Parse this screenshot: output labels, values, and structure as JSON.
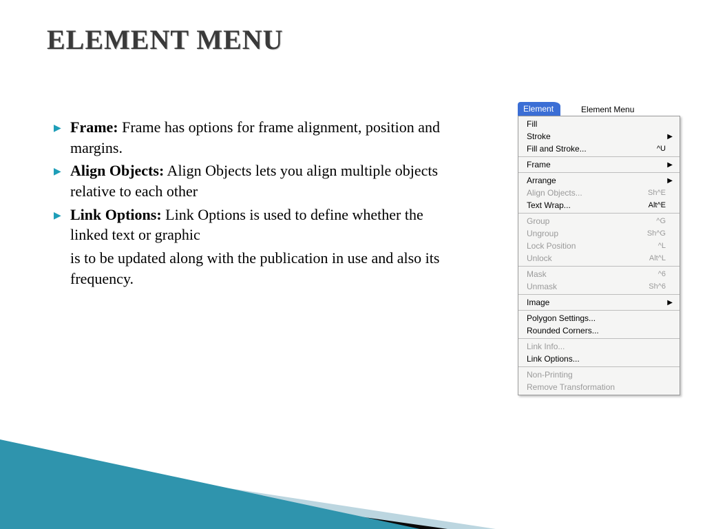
{
  "title": "ELEMENT MENU",
  "bullets": [
    {
      "label": "Frame:",
      "text": " Frame has options for frame alignment, position and margins."
    },
    {
      "label": " Align Objects:",
      "text": " Align Objects  lets  you align  multiple  objects  relative  to each other"
    },
    {
      "label": "Link Options:",
      "text": "  Link Options is used to define whether the linked text or graphic"
    }
  ],
  "continuation": "is to be updated along with the publication in use and also its frequency.",
  "menu": {
    "tab": "Element",
    "caption": "Element Menu",
    "groups": [
      [
        {
          "label": "Fill",
          "shortcut": "",
          "arrow": false,
          "disabled": false
        },
        {
          "label": "Stroke",
          "shortcut": "",
          "arrow": true,
          "disabled": false
        },
        {
          "label": "Fill and Stroke...",
          "shortcut": "^U",
          "arrow": false,
          "disabled": false
        }
      ],
      [
        {
          "label": "Frame",
          "shortcut": "",
          "arrow": true,
          "disabled": false
        }
      ],
      [
        {
          "label": "Arrange",
          "shortcut": "",
          "arrow": true,
          "disabled": false
        },
        {
          "label": "Align Objects...",
          "shortcut": "Sh^E",
          "arrow": false,
          "disabled": true
        },
        {
          "label": "Text Wrap...",
          "shortcut": "Alt^E",
          "arrow": false,
          "disabled": false
        }
      ],
      [
        {
          "label": "Group",
          "shortcut": "^G",
          "arrow": false,
          "disabled": true
        },
        {
          "label": "Ungroup",
          "shortcut": "Sh^G",
          "arrow": false,
          "disabled": true
        },
        {
          "label": "Lock Position",
          "shortcut": "^L",
          "arrow": false,
          "disabled": true
        },
        {
          "label": "Unlock",
          "shortcut": "Alt^L",
          "arrow": false,
          "disabled": true
        }
      ],
      [
        {
          "label": "Mask",
          "shortcut": "^6",
          "arrow": false,
          "disabled": true
        },
        {
          "label": "Unmask",
          "shortcut": "Sh^6",
          "arrow": false,
          "disabled": true
        }
      ],
      [
        {
          "label": "Image",
          "shortcut": "",
          "arrow": true,
          "disabled": false
        }
      ],
      [
        {
          "label": "Polygon Settings...",
          "shortcut": "",
          "arrow": false,
          "disabled": false
        },
        {
          "label": "Rounded Corners...",
          "shortcut": "",
          "arrow": false,
          "disabled": false
        }
      ],
      [
        {
          "label": "Link Info...",
          "shortcut": "",
          "arrow": false,
          "disabled": true
        },
        {
          "label": "Link Options...",
          "shortcut": "",
          "arrow": false,
          "disabled": false
        }
      ],
      [
        {
          "label": "Non-Printing",
          "shortcut": "",
          "arrow": false,
          "disabled": true
        },
        {
          "label": "Remove Transformation",
          "shortcut": "",
          "arrow": false,
          "disabled": true
        }
      ]
    ]
  }
}
